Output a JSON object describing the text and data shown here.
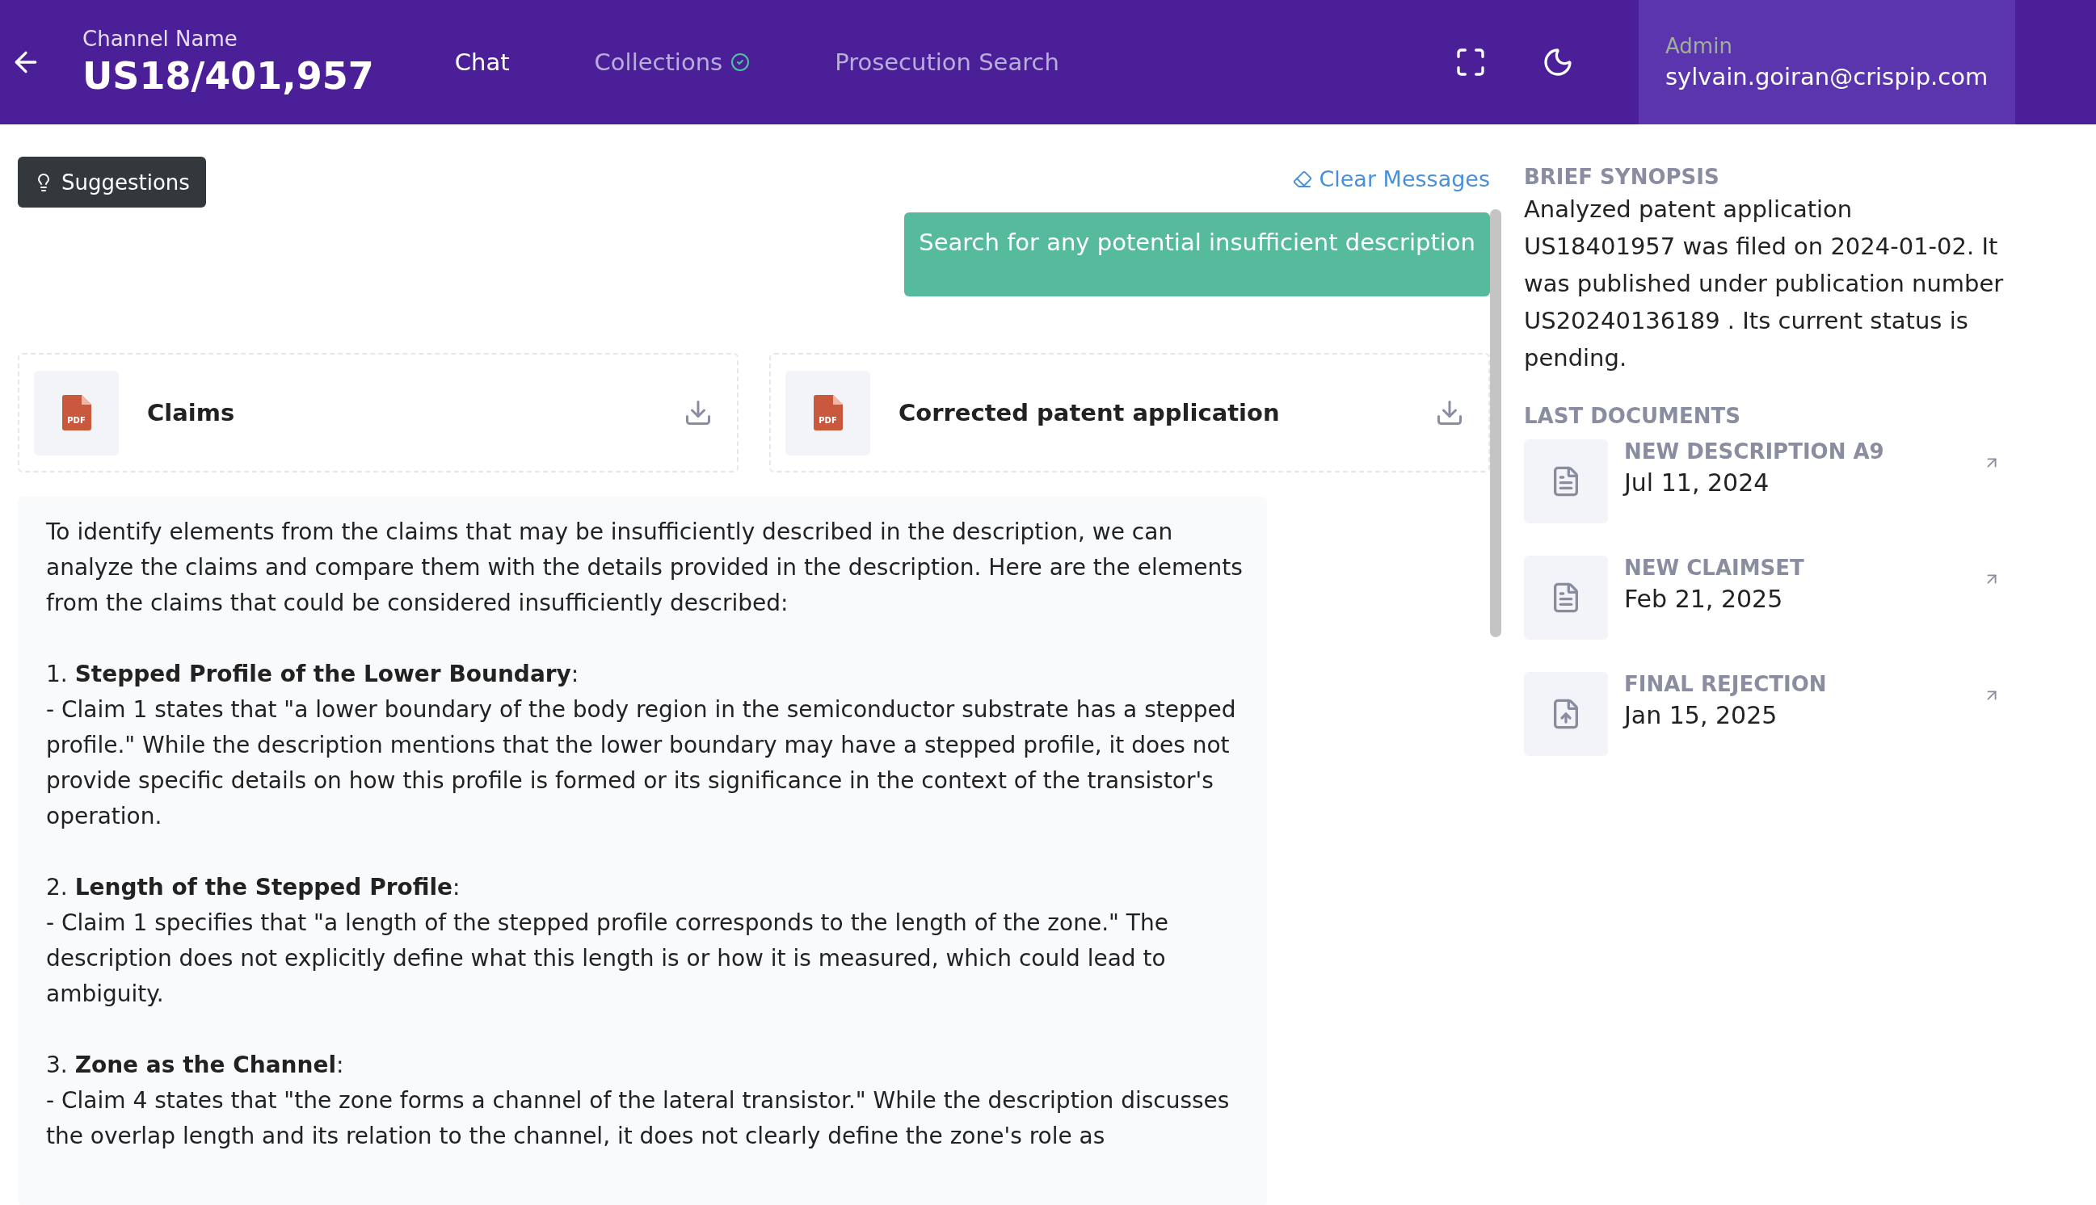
{
  "header": {
    "channel_label": "Channel Name",
    "channel_name": "US18/401,957",
    "tabs": [
      {
        "label": "Chat",
        "selected": true,
        "verified": false
      },
      {
        "label": "Collections",
        "selected": false,
        "verified": true
      },
      {
        "label": "Prosecution Search",
        "selected": false,
        "verified": false
      }
    ],
    "user": {
      "role": "Admin",
      "email": "sylvain.goiran@crispip.com"
    }
  },
  "chat": {
    "suggestions_button": "Suggestions",
    "clear_button": "Clear Messages",
    "user_message": "Search for any potential insufficient description",
    "files": [
      {
        "type_label": "PDF",
        "name": "Claims"
      },
      {
        "type_label": "PDF",
        "name": "Corrected patent application"
      }
    ],
    "answer": {
      "intro": "To identify elements from the claims that may be insufficiently described in the description, we can analyze the claims and compare them with the details provided in the description. Here are the elements from the claims that could be considered insufficiently described:",
      "points": [
        {
          "heading": "1. **Stepped Profile of the Lower Boundary**:",
          "body": "- Claim 1 states that \"a lower boundary of the body region in the semiconductor substrate has a stepped profile.\" While the description mentions that the lower boundary may have a stepped profile, it does not provide specific details on how this profile is formed or its significance in the context of the transistor's operation."
        },
        {
          "heading": "2. **Length of the Stepped Profile**:",
          "body": "- Claim 1 specifies that \"a length of the stepped profile corresponds to the length of the zone.\" The description does not explicitly define what this length is or how it is measured, which could lead to ambiguity."
        },
        {
          "heading": "3. **Zone as the Channel**:",
          "body": "- Claim 4 states that \"the zone forms a channel of the lateral transistor.\" While the description discusses the overlap length and its relation to the channel, it does not clearly define the zone's role as"
        }
      ]
    }
  },
  "sidebar": {
    "synopsis_title": "BRIEF SYNOPSIS",
    "synopsis": "Analyzed patent application US18401957 was filed on 2024-01-02. It was published under publication number US20240136189 . Its current status is pending.",
    "documents_title": "LAST DOCUMENTS",
    "documents": [
      {
        "kind": "text",
        "title": "NEW DESCRIPTION A9",
        "date": "Jul 11, 2024"
      },
      {
        "kind": "text",
        "title": "NEW CLAIMSET",
        "date": "Feb 21, 2025"
      },
      {
        "kind": "upload",
        "title": "FINAL REJECTION",
        "date": "Jan 15, 2025"
      }
    ]
  }
}
